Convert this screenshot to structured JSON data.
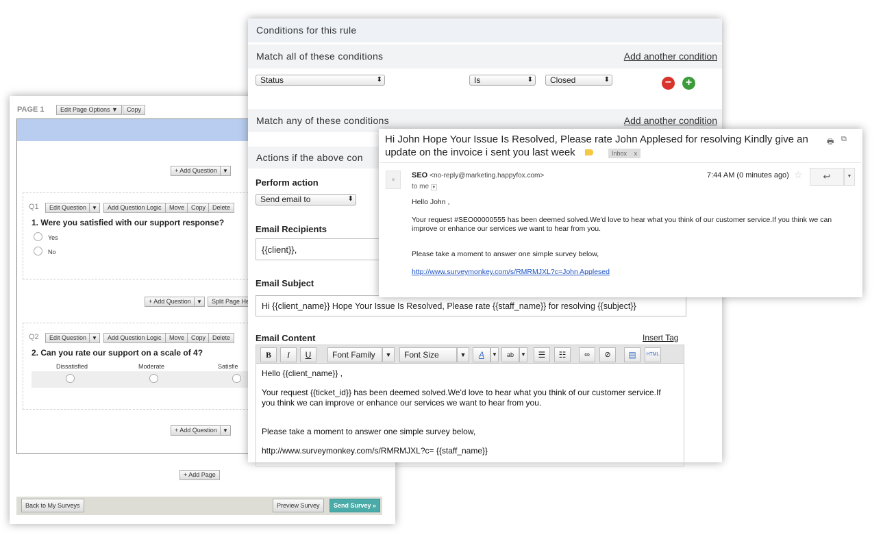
{
  "survey": {
    "page_label": "PAGE 1",
    "edit_page_options": "Edit Page Options ▼",
    "copy": "Copy",
    "add_question": "+ Add Question",
    "split_page": "Split Page He",
    "add_page": "+ Add Page",
    "back": "Back to My Surveys",
    "preview": "Preview Survey",
    "send": "Send Survey »",
    "q1": {
      "num": "Q1",
      "edit": "Edit Question",
      "logic": "Add Question Logic",
      "move": "Move",
      "copy": "Copy",
      "delete": "Delete",
      "title": "1. Were you satisfied with our support response?",
      "options": [
        "Yes",
        "No"
      ]
    },
    "q2": {
      "num": "Q2",
      "edit": "Edit Question",
      "logic": "Add Question Logic",
      "move": "Move",
      "copy": "Copy",
      "delete": "Delete",
      "title": "2. Can you rate our support on a scale of 4?",
      "scale": [
        "Dissatisfied",
        "Moderate",
        "Satisfie"
      ]
    }
  },
  "rule": {
    "header": "Conditions for this rule",
    "match_all": "Match all of these conditions",
    "add_condition": "Add another condition",
    "field": "Status",
    "operator": "Is",
    "value": "Closed",
    "match_any": "Match any of these conditions",
    "actions": "Actions if the above con",
    "perform_label": "Perform action",
    "perform_value": "Send email to",
    "recipients_label": "Email Recipients",
    "recipients_value": "{{client}},",
    "subject_label": "Email Subject",
    "subject_value": "Hi {{client_name}} Hope Your Issue Is Resolved, Please rate {{staff_name}} for resolving {{subject}}",
    "content_label": "Email Content",
    "insert_tag": "Insert Tag",
    "font_family": "Font Family",
    "font_size": "Font Size",
    "body": [
      "Hello {{client_name}} ,",
      "Your request {{ticket_id}}  has been deemed solved.We'd love to hear what you think of our customer service.If you think we can improve or enhance our services we want to hear from you.",
      "Please take a moment to answer one simple survey below,",
      "http://www.surveymonkey.com/s/RMRMJXL?c= {{staff_name}}"
    ]
  },
  "email": {
    "subject": "Hi John Hope Your Issue Is Resolved, Please rate  John Applesed   for resolving Kindly give an update on the invoice i sent you last week",
    "label": "Inbox",
    "label_close": "x",
    "sender": "SEO",
    "sender_email": "<no-reply@marketing.happyfox.com>",
    "to": "to me",
    "time": "7:44 AM (0 minutes ago)",
    "body": [
      "Hello John ,",
      "Your request #SEO00000555  has been deemed solved.We'd love to hear what you think of our customer service.If you think we can improve or enhance our services we want to hear from you.",
      "Please take a moment to answer one simple survey below,"
    ],
    "link": "http://www.surveymonkey.com/s/RMRMJXL?c=John Applesed"
  },
  "colors": {
    "accent_blue": "#b8cdef",
    "send_button": "#4aaba8",
    "remove": "#d9342b",
    "add": "#3c9c3c"
  }
}
